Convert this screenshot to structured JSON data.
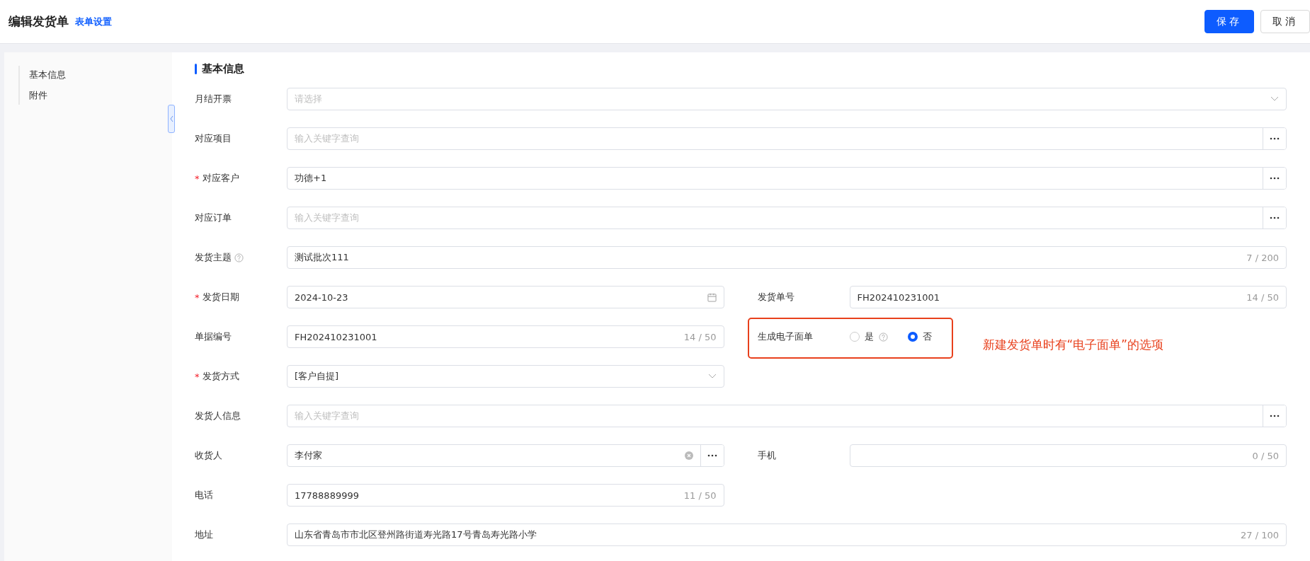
{
  "header": {
    "title": "编辑发货单",
    "settings_link": "表单设置",
    "buttons": [
      {
        "label": "保存",
        "kind": "primary"
      },
      {
        "label": "取消",
        "kind": "default"
      }
    ]
  },
  "sidebar": {
    "items": [
      {
        "label": "基本信息"
      },
      {
        "label": "附件"
      }
    ]
  },
  "section": {
    "title": "基本信息"
  },
  "required_mark": "*",
  "rows": [
    {
      "fields": [
        {
          "label": "月结开票",
          "required": false,
          "kind": "select",
          "full_width": true,
          "placeholder": "请选择"
        }
      ]
    },
    {
      "fields": [
        {
          "label": "对应项目",
          "required": false,
          "kind": "lookup",
          "full_width": true,
          "placeholder": "输入关键字查询"
        }
      ]
    },
    {
      "fields": [
        {
          "label": "对应客户",
          "required": true,
          "kind": "lookup",
          "full_width": true,
          "value": "功德+1"
        }
      ]
    },
    {
      "fields": [
        {
          "label": "对应订单",
          "required": false,
          "kind": "lookup",
          "full_width": true,
          "placeholder": "输入关键字查询"
        }
      ]
    },
    {
      "fields": [
        {
          "label": "发货主题",
          "required": false,
          "help": true,
          "kind": "text",
          "full_width": true,
          "value": "测试批次111",
          "counter": "7 / 200"
        }
      ]
    },
    {
      "fields": [
        {
          "label": "发货日期",
          "required": true,
          "kind": "date",
          "value": "2024-10-23"
        },
        {
          "label": "发货单号",
          "required": false,
          "kind": "text",
          "value": "FH202410231001",
          "counter": "14 / 50"
        }
      ]
    },
    {
      "fields": [
        {
          "label": "单据编号",
          "required": false,
          "kind": "text",
          "value": "FH202410231001",
          "counter": "14 / 50"
        },
        {
          "label": "生成电子面单",
          "required": false,
          "kind": "radio",
          "highlighted": true,
          "annotation": "新建发货单时有“电子面单”的选项",
          "options": [
            {
              "label": "是",
              "selected": false,
              "help": true
            },
            {
              "label": "否",
              "selected": true
            }
          ]
        }
      ]
    },
    {
      "fields": [
        {
          "label": "发货方式",
          "required": true,
          "kind": "select",
          "full_width": false,
          "value": "[客户自提]"
        }
      ]
    },
    {
      "fields": [
        {
          "label": "发货人信息",
          "required": false,
          "kind": "lookup",
          "full_width": true,
          "placeholder": "输入关键字查询"
        }
      ]
    },
    {
      "fields": [
        {
          "label": "收货人",
          "required": false,
          "kind": "lookup",
          "clearable": true,
          "value": "李付家"
        },
        {
          "label": "手机",
          "required": false,
          "kind": "text",
          "counter": "0 / 50"
        }
      ]
    },
    {
      "fields": [
        {
          "label": "电话",
          "required": false,
          "kind": "text",
          "full_width": false,
          "value": "17788889999",
          "counter": "11 / 50"
        }
      ]
    },
    {
      "fields": [
        {
          "label": "地址",
          "required": false,
          "kind": "text",
          "full_width": true,
          "value": "山东省青岛市市北区登州路街道寿光路17号青岛寿光路小学",
          "counter": "27 / 100"
        }
      ]
    }
  ]
}
